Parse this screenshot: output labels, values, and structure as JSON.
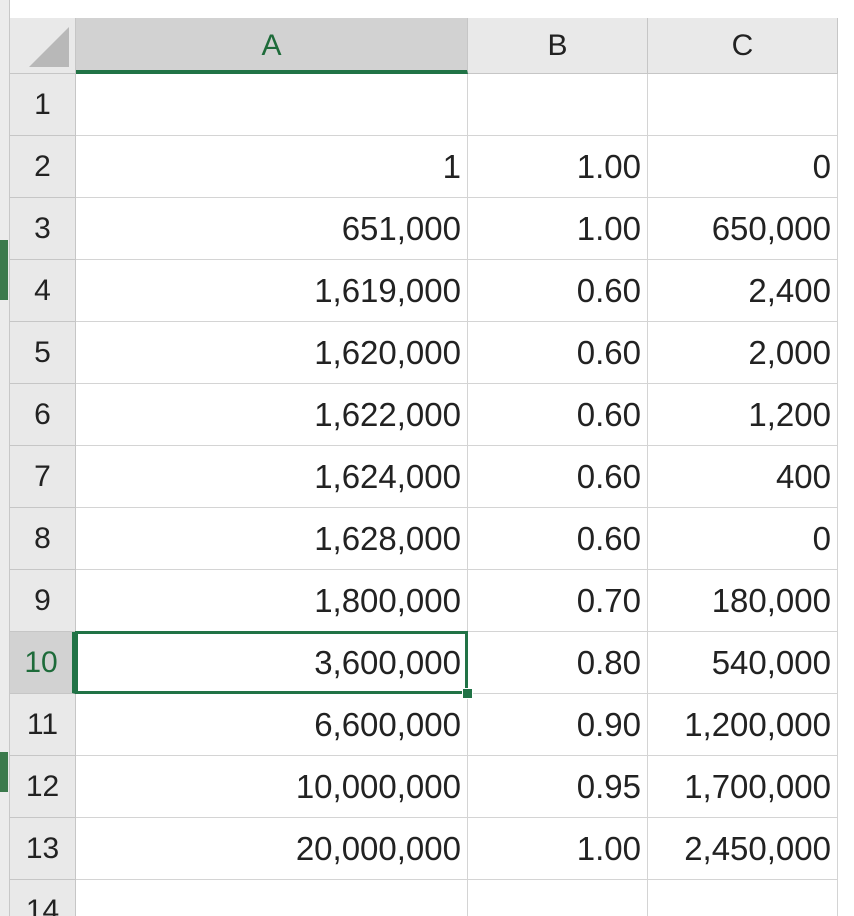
{
  "spreadsheet": {
    "active_cell": {
      "row": 10,
      "col": "A"
    },
    "columns": [
      {
        "label": "A"
      },
      {
        "label": "B"
      },
      {
        "label": "C"
      }
    ],
    "rows": [
      {
        "label": "1",
        "cells": [
          "",
          "",
          ""
        ]
      },
      {
        "label": "2",
        "cells": [
          "1",
          "1.00",
          "0"
        ]
      },
      {
        "label": "3",
        "cells": [
          "651,000",
          "1.00",
          "650,000"
        ]
      },
      {
        "label": "4",
        "cells": [
          "1,619,000",
          "0.60",
          "2,400"
        ]
      },
      {
        "label": "5",
        "cells": [
          "1,620,000",
          "0.60",
          "2,000"
        ]
      },
      {
        "label": "6",
        "cells": [
          "1,622,000",
          "0.60",
          "1,200"
        ]
      },
      {
        "label": "7",
        "cells": [
          "1,624,000",
          "0.60",
          "400"
        ]
      },
      {
        "label": "8",
        "cells": [
          "1,628,000",
          "0.60",
          "0"
        ]
      },
      {
        "label": "9",
        "cells": [
          "1,800,000",
          "0.70",
          "180,000"
        ]
      },
      {
        "label": "10",
        "cells": [
          "3,600,000",
          "0.80",
          "540,000"
        ]
      },
      {
        "label": "11",
        "cells": [
          "6,600,000",
          "0.90",
          "1,200,000"
        ]
      },
      {
        "label": "12",
        "cells": [
          "10,000,000",
          "0.95",
          "1,700,000"
        ]
      },
      {
        "label": "13",
        "cells": [
          "20,000,000",
          "1.00",
          "2,450,000"
        ]
      },
      {
        "label": "14",
        "cells": [
          "",
          "",
          ""
        ]
      }
    ]
  },
  "colors": {
    "selection": "#217346",
    "header_bg": "#e9e9e9",
    "header_selected_bg": "#d2d2d2",
    "grid_line": "#d4d4d4"
  }
}
